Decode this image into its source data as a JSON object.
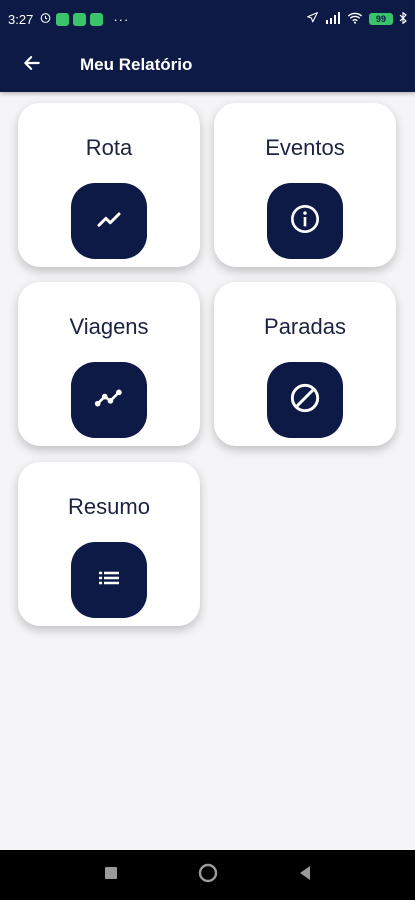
{
  "status_bar": {
    "time": "3:27",
    "dots": "···",
    "battery": "99"
  },
  "header": {
    "title": "Meu Relatório"
  },
  "cards": [
    {
      "label": "Rota",
      "icon": "trending-up-icon"
    },
    {
      "label": "Eventos",
      "icon": "info-icon"
    },
    {
      "label": "Viagens",
      "icon": "timeline-icon"
    },
    {
      "label": "Paradas",
      "icon": "block-icon"
    },
    {
      "label": "Resumo",
      "icon": "list-icon"
    }
  ],
  "colors": {
    "primary": "#0d1a45",
    "background": "#f5f5f7",
    "card": "#ffffff"
  }
}
